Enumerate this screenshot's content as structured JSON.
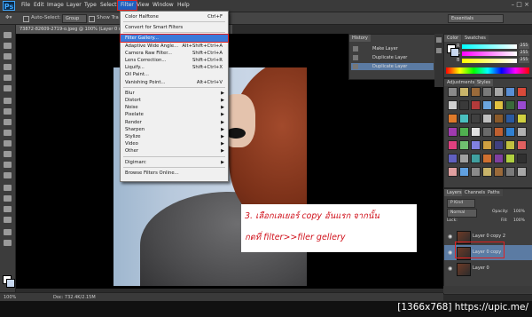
{
  "app": {
    "logo": "Ps"
  },
  "menubar": {
    "items": [
      "File",
      "Edit",
      "Image",
      "Layer",
      "Type",
      "Select",
      "Filter",
      "View",
      "Window",
      "Help"
    ],
    "window_controls": "– □ ×"
  },
  "options": {
    "auto_select_label": "Auto-Select:",
    "auto_select_value": "Group",
    "show_transform": "Show Tra",
    "workspace": "Essentials"
  },
  "document": {
    "tab_title": "73872-82609-2719-o.jpeg @ 100% (Layer 0 copy, RGB/8)"
  },
  "filter_menu": {
    "items": [
      {
        "type": "item",
        "label": "Color Halftone",
        "shortcut": "Ctrl+F"
      },
      {
        "type": "sep"
      },
      {
        "type": "item",
        "label": "Convert for Smart Filters",
        "shortcut": ""
      },
      {
        "type": "sep"
      },
      {
        "type": "item",
        "label": "Filter Gallery...",
        "shortcut": "",
        "highlight": true
      },
      {
        "type": "item",
        "label": "Adaptive Wide Angle...",
        "shortcut": "Alt+Shift+Ctrl+A"
      },
      {
        "type": "item",
        "label": "Camera Raw Filter...",
        "shortcut": "Shift+Ctrl+A"
      },
      {
        "type": "item",
        "label": "Lens Correction...",
        "shortcut": "Shift+Ctrl+R"
      },
      {
        "type": "item",
        "label": "Liquify...",
        "shortcut": "Shift+Ctrl+X"
      },
      {
        "type": "item",
        "label": "Oil Paint...",
        "shortcut": ""
      },
      {
        "type": "item",
        "label": "Vanishing Point...",
        "shortcut": "Alt+Ctrl+V"
      },
      {
        "type": "sep"
      },
      {
        "type": "sub",
        "label": "Blur"
      },
      {
        "type": "sub",
        "label": "Distort"
      },
      {
        "type": "sub",
        "label": "Noise"
      },
      {
        "type": "sub",
        "label": "Pixelate"
      },
      {
        "type": "sub",
        "label": "Render"
      },
      {
        "type": "sub",
        "label": "Sharpen"
      },
      {
        "type": "sub",
        "label": "Stylize"
      },
      {
        "type": "sub",
        "label": "Video"
      },
      {
        "type": "sub",
        "label": "Other"
      },
      {
        "type": "sep"
      },
      {
        "type": "sub",
        "label": "Digimarc"
      },
      {
        "type": "sep"
      },
      {
        "type": "item",
        "label": "Browse Filters Online...",
        "shortcut": ""
      }
    ]
  },
  "history_panel": {
    "tabs": [
      "History"
    ],
    "rows": [
      "Make Layer",
      "Duplicate Layer",
      "Duplicate Layer"
    ]
  },
  "color_panel": {
    "tabs": [
      "Color",
      "Swatches"
    ],
    "channels": [
      {
        "label": "R",
        "value": "255"
      },
      {
        "label": "G",
        "value": "255"
      },
      {
        "label": "B",
        "value": "255"
      }
    ]
  },
  "styles_panel": {
    "tabs": [
      "Adjustments",
      "Styles"
    ]
  },
  "layers_panel": {
    "tabs": [
      "Layers",
      "Channels",
      "Paths"
    ],
    "kind_label": "P Kind",
    "blend_mode": "Normal",
    "opacity_label": "Opacity:",
    "opacity_value": "100%",
    "lock_label": "Lock:",
    "fill_label": "Fill:",
    "fill_value": "100%",
    "layers": [
      {
        "name": "Layer 0 copy 2",
        "selected": false
      },
      {
        "name": "Layer 0 copy",
        "selected": true
      },
      {
        "name": "Layer 0",
        "selected": false
      }
    ]
  },
  "status": {
    "zoom": "100%",
    "doc_info": "Doc: 732.4K/2.15M"
  },
  "annotation": {
    "line1": "3. เลือกเลเยอร์ copy อันแรก จากนั้น",
    "line2": "กดที่ filter>>filer gellery"
  },
  "caption": "[1366x768] https://upic.me/"
}
